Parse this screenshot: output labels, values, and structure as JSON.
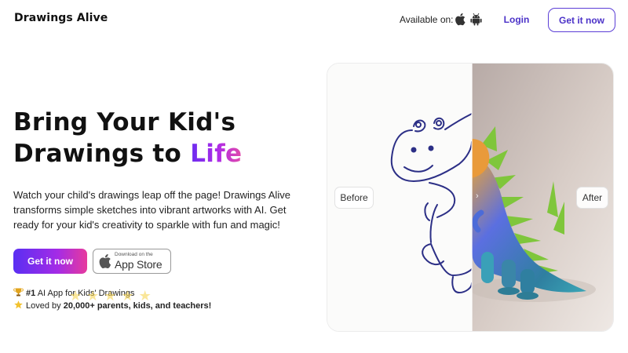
{
  "header": {
    "logo": "Drawings Alive",
    "available_on": "Available on:",
    "login": "Login",
    "get_it_now": "Get it now",
    "platform_icons": [
      "apple-icon",
      "android-icon"
    ]
  },
  "hero": {
    "title_line1": "Bring Your Kid's",
    "title_line2_prefix": "Drawings to ",
    "title_highlight": "Life",
    "description": "Watch your child's drawings leap off the page! Drawings Alive transforms simple sketches into vibrant artworks with AI. Get ready for your kid's creativity to sparkle with fun and magic!",
    "cta_primary": "Get it now",
    "appstore_small": "Download on the",
    "appstore_big": "App Store"
  },
  "badges": {
    "badge1_bold": "#1",
    "badge1_text": " AI App for Kids' Drawings",
    "badge2_prefix": "Loved by ",
    "badge2_bold": "20,000+ parents, kids, and teachers!",
    "icons": [
      "trophy-icon",
      "star-icon"
    ]
  },
  "compare": {
    "before_label": "Before",
    "after_label": "After",
    "handle_glyph": "›"
  },
  "colors": {
    "brand_purple": "#4b32c8",
    "gradient_start": "#5a2ff2",
    "gradient_end": "#e73a9d"
  }
}
